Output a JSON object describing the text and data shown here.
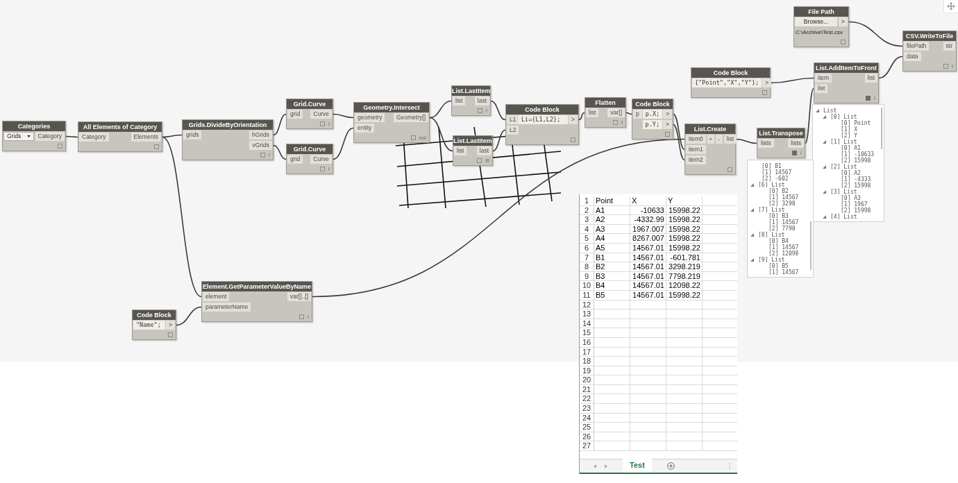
{
  "canvas": {
    "nodes": [
      {
        "kind": "dropdown",
        "title": "Categories",
        "value": "Grids",
        "outputs": [
          "Category"
        ],
        "preview_pinned": false
      },
      {
        "kind": "standard",
        "title": "All Elements of Category",
        "inputs": [
          "Category"
        ],
        "outputs": [
          "Elements"
        ],
        "preview_pinned": false
      },
      {
        "kind": "standard",
        "title": "Grids.DivideByOrientation",
        "inputs": [
          "grids"
        ],
        "outputs": [
          "hGrids",
          "vGrids"
        ],
        "preview_pinned": false,
        "lacing": "I"
      },
      {
        "kind": "standard",
        "title": "Grid.Curve",
        "inputs": [
          "grid"
        ],
        "outputs": [
          "Curve"
        ],
        "preview_pinned": false,
        "lacing": "I"
      },
      {
        "kind": "standard",
        "title": "Grid.Curve",
        "inputs": [
          "grid"
        ],
        "outputs": [
          "Curve"
        ],
        "preview_pinned": false,
        "lacing": "I"
      },
      {
        "kind": "standard",
        "title": "Geometry.Intersect",
        "inputs": [
          "geometry",
          "entity"
        ],
        "outputs": [
          "Geometry[]"
        ],
        "preview_pinned": false,
        "lacing": "xxx"
      },
      {
        "kind": "standard",
        "title": "List.LastItem",
        "inputs": [
          "list"
        ],
        "outputs": [
          "last"
        ],
        "preview_pinned": false,
        "lacing": "I"
      },
      {
        "kind": "standard",
        "title": "List.LastItem",
        "inputs": [
          "list"
        ],
        "outputs": [
          "last"
        ],
        "preview_pinned": false,
        "lacing": "III"
      },
      {
        "kind": "code",
        "title": "Code Block",
        "inputs": [
          "L1",
          "L2"
        ],
        "code": [
          "Li={L1,L2};"
        ],
        "outputs": [
          ">"
        ],
        "preview_pinned": false
      },
      {
        "kind": "standard",
        "title": "Flatten",
        "inputs": [
          "list"
        ],
        "outputs": [
          "var[]"
        ],
        "preview_pinned": false,
        "lacing": "I"
      },
      {
        "kind": "code",
        "title": "Code Block",
        "inputs": [
          "p"
        ],
        "code": [
          "p.X;",
          "p.Y;"
        ],
        "outputs": [
          ">",
          ">"
        ],
        "preview_pinned": false
      },
      {
        "kind": "list_create",
        "title": "List.Create",
        "inputs": [
          "item0",
          "item1",
          "item2"
        ],
        "controls": [
          "+",
          "-"
        ],
        "outputs": [
          "list"
        ],
        "preview_pinned": false
      },
      {
        "kind": "standard",
        "title": "List.Transpose",
        "inputs": [
          "lists"
        ],
        "outputs": [
          "lists"
        ],
        "preview_pinned": true,
        "lacing": "I"
      },
      {
        "kind": "code",
        "title": "Code Block",
        "code": [
          "{\"Point\",\"X\",\"Y\"};"
        ],
        "outputs": [
          ">"
        ],
        "preview_pinned": false
      },
      {
        "kind": "file_path",
        "title": "File Path",
        "button": "Browse...",
        "outputs": [
          ">"
        ],
        "path": "C:\\Archive\\Test.csv",
        "preview_pinned": false
      },
      {
        "kind": "standard",
        "title": "List.AddItemToFront",
        "inputs": [
          "item",
          "list"
        ],
        "outputs": [
          "list"
        ],
        "preview_pinned": true,
        "lacing": "I"
      },
      {
        "kind": "standard",
        "title": "CSV.WriteToFile",
        "inputs": [
          "filePath",
          "data"
        ],
        "outputs": [
          "str"
        ],
        "preview_pinned": false,
        "lacing": "I"
      },
      {
        "kind": "standard",
        "title": "Element.GetParameterValueByName",
        "inputs": [
          "element",
          "parameterName"
        ],
        "outputs": [
          "var[]..[]"
        ],
        "preview_pinned": false,
        "lacing": "I"
      },
      {
        "kind": "code",
        "title": "Code Block",
        "code": [
          "\"Name\";"
        ],
        "outputs": [
          ">"
        ],
        "preview_pinned": false
      }
    ],
    "previews": [
      {
        "items": [
          {
            "label": "List",
            "expanded": true,
            "children": [
              {
                "label": "[0] List",
                "expanded": true,
                "children": [
                  {
                    "label": "[0] Point"
                  },
                  {
                    "label": "[1] X"
                  },
                  {
                    "label": "[2] Y"
                  }
                ]
              },
              {
                "label": "[1] List",
                "expanded": true,
                "children": [
                  {
                    "label": "[0] A1"
                  },
                  {
                    "label": "[1] -10633"
                  },
                  {
                    "label": "[2] 15998"
                  }
                ]
              },
              {
                "label": "[2] List",
                "expanded": true,
                "children": [
                  {
                    "label": "[0] A2"
                  },
                  {
                    "label": "[1] -4333"
                  },
                  {
                    "label": "[2] 15998"
                  }
                ]
              },
              {
                "label": "[3] List",
                "expanded": true,
                "children": [
                  {
                    "label": "[0] A3"
                  },
                  {
                    "label": "[1] 1967"
                  },
                  {
                    "label": "[2] 15998"
                  }
                ]
              },
              {
                "label": "[4] List",
                "expanded": true
              }
            ]
          }
        ]
      },
      {
        "items": [
          {
            "label": "[0] B1"
          },
          {
            "label": "[1] 14567"
          },
          {
            "label": "[2] -602"
          },
          {
            "label": "[6] List",
            "expanded": true,
            "children": [
              {
                "label": "[0] B2"
              },
              {
                "label": "[1] 14567"
              },
              {
                "label": "[2] 3298"
              }
            ]
          },
          {
            "label": "[7] List",
            "expanded": true,
            "children": [
              {
                "label": "[0] B3"
              },
              {
                "label": "[1] 14567"
              },
              {
                "label": "[2] 7798"
              }
            ]
          },
          {
            "label": "[8] List",
            "expanded": true,
            "children": [
              {
                "label": "[0] B4"
              },
              {
                "label": "[1] 14567"
              },
              {
                "label": "[2] 12098"
              }
            ]
          },
          {
            "label": "[9] List",
            "expanded": true,
            "children": [
              {
                "label": "[0] B5"
              },
              {
                "label": "[1] 14567"
              }
            ]
          }
        ]
      }
    ]
  },
  "spreadsheet": {
    "rows": [
      {
        "number": "1",
        "cells": [
          "Point",
          "X",
          "Y"
        ]
      },
      {
        "number": "2",
        "cells": [
          "A1",
          "-10633",
          "15998.22"
        ]
      },
      {
        "number": "3",
        "cells": [
          "A2",
          "-4332.99",
          "15998.22"
        ]
      },
      {
        "number": "4",
        "cells": [
          "A3",
          "1967.007",
          "15998.22"
        ]
      },
      {
        "number": "5",
        "cells": [
          "A4",
          "8267.007",
          "15998.22"
        ]
      },
      {
        "number": "6",
        "cells": [
          "A5",
          "14567.01",
          "15998.22"
        ]
      },
      {
        "number": "7",
        "cells": [
          "B1",
          "14567.01",
          "-601.781"
        ]
      },
      {
        "number": "8",
        "cells": [
          "B2",
          "14567.01",
          "3298.219"
        ]
      },
      {
        "number": "9",
        "cells": [
          "B3",
          "14567.01",
          "7798.219"
        ]
      },
      {
        "number": "10",
        "cells": [
          "B4",
          "14567.01",
          "12098.22"
        ]
      },
      {
        "number": "11",
        "cells": [
          "B5",
          "14567.01",
          "15998.22"
        ]
      },
      {
        "number": "12"
      },
      {
        "number": "13"
      },
      {
        "number": "14"
      },
      {
        "number": "15"
      },
      {
        "number": "16"
      },
      {
        "number": "17"
      },
      {
        "number": "18"
      },
      {
        "number": "19"
      },
      {
        "number": "20"
      },
      {
        "number": "21"
      },
      {
        "number": "22"
      },
      {
        "number": "23"
      },
      {
        "number": "24"
      },
      {
        "number": "25"
      },
      {
        "number": "26"
      },
      {
        "number": "27"
      }
    ],
    "tabs": [
      {
        "label": "Test",
        "selected": true
      }
    ]
  }
}
